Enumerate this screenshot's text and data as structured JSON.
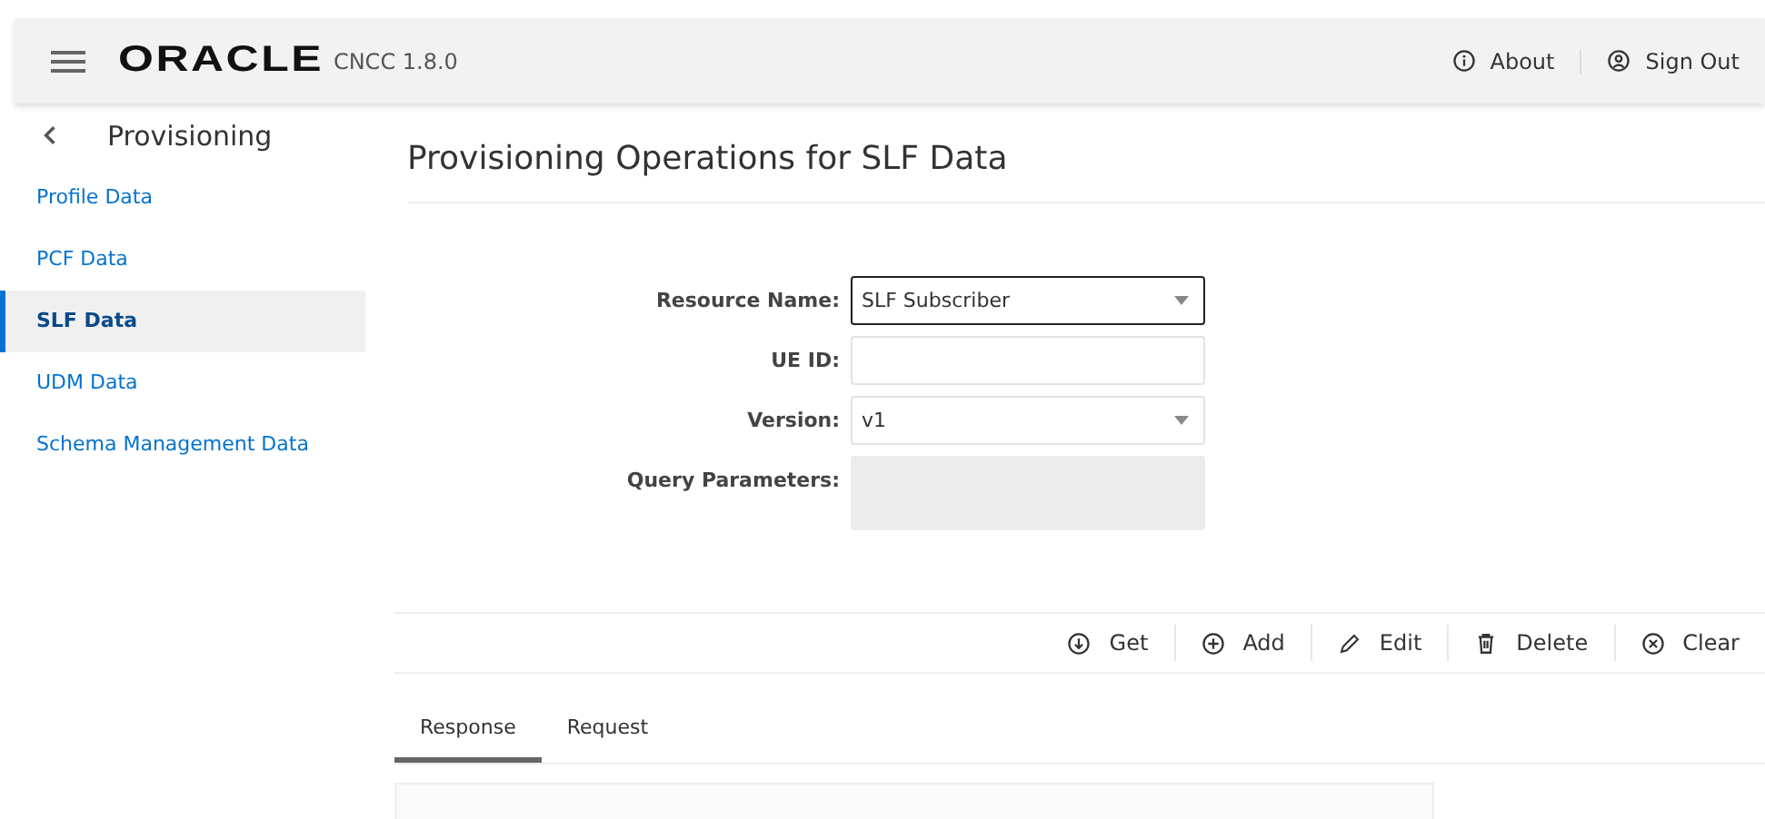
{
  "header": {
    "logo": "ORACLE",
    "product": "CNCC 1.8.0",
    "actions": [
      {
        "kind": "info",
        "label": "About"
      },
      {
        "kind": "user",
        "label": "Sign Out"
      }
    ]
  },
  "sidebar": {
    "title": "Provisioning",
    "items": [
      {
        "label": "Profile Data",
        "selected": false
      },
      {
        "label": "PCF Data",
        "selected": false
      },
      {
        "label": "SLF Data",
        "selected": true
      },
      {
        "label": "UDM Data",
        "selected": false
      },
      {
        "label": "Schema Management Data",
        "selected": false
      }
    ]
  },
  "page_title": "Provisioning Operations for SLF Data",
  "form": [
    {
      "label": "Resource Name:",
      "kind": "select",
      "value": "SLF Subscriber",
      "focused": true
    },
    {
      "label": "UE ID:",
      "kind": "text",
      "focused": false
    },
    {
      "label": "Version:",
      "kind": "select",
      "value": "v1",
      "focused": false
    },
    {
      "label": "Query Parameters:",
      "kind": "textarea",
      "disabled": true,
      "focused": false
    }
  ],
  "toolbar": [
    {
      "kind": "get",
      "label": "Get"
    },
    {
      "kind": "add",
      "label": "Add"
    },
    {
      "kind": "edit",
      "label": "Edit"
    },
    {
      "kind": "delete",
      "label": "Delete"
    },
    {
      "kind": "clear",
      "label": "Clear"
    }
  ],
  "tabs": [
    {
      "label": "Response",
      "selected": true
    },
    {
      "label": "Request",
      "selected": false
    }
  ]
}
